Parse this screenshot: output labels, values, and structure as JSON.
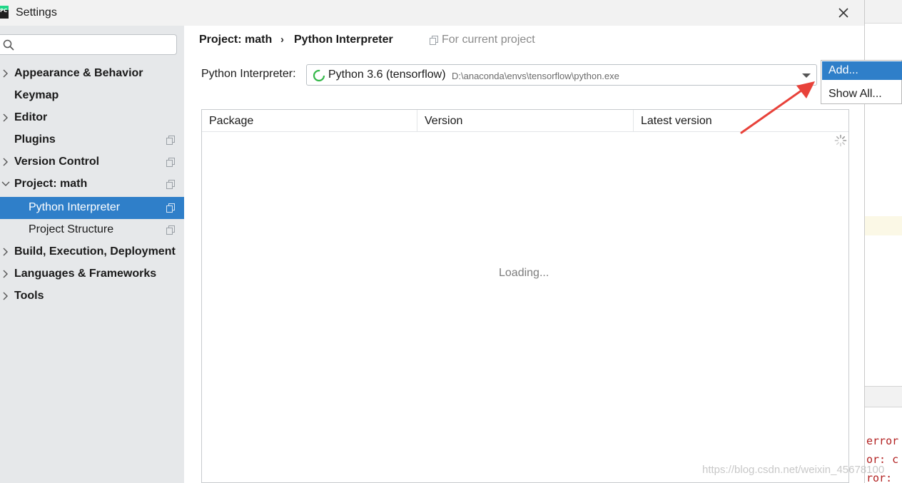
{
  "window": {
    "title": "Settings",
    "logo_text": "PC"
  },
  "sidebar": {
    "search": {
      "value": "",
      "placeholder": ""
    },
    "items": [
      {
        "label": "Appearance & Behavior",
        "expandable": true,
        "expanded": false,
        "level": 0,
        "has_copy_icon": false
      },
      {
        "label": "Keymap",
        "expandable": false,
        "level": 0,
        "has_copy_icon": false
      },
      {
        "label": "Editor",
        "expandable": true,
        "expanded": false,
        "level": 0,
        "has_copy_icon": false
      },
      {
        "label": "Plugins",
        "expandable": false,
        "level": 0,
        "has_copy_icon": true
      },
      {
        "label": "Version Control",
        "expandable": true,
        "expanded": false,
        "level": 0,
        "has_copy_icon": true
      },
      {
        "label": "Project: math",
        "expandable": true,
        "expanded": true,
        "level": 0,
        "has_copy_icon": true
      },
      {
        "label": "Python Interpreter",
        "expandable": false,
        "level": 1,
        "has_copy_icon": true,
        "selected": true
      },
      {
        "label": "Project Structure",
        "expandable": false,
        "level": 1,
        "has_copy_icon": true
      },
      {
        "label": "Build, Execution, Deployment",
        "expandable": true,
        "expanded": false,
        "level": 0,
        "has_copy_icon": false
      },
      {
        "label": "Languages & Frameworks",
        "expandable": true,
        "expanded": false,
        "level": 0,
        "has_copy_icon": false
      },
      {
        "label": "Tools",
        "expandable": true,
        "expanded": false,
        "level": 0,
        "has_copy_icon": false
      }
    ]
  },
  "breadcrumb": {
    "project": "Project: math",
    "separator": "›",
    "page": "Python Interpreter",
    "scope": "For current project"
  },
  "interpreter": {
    "label": "Python Interpreter:",
    "selected_name": "Python 3.6 (tensorflow)",
    "selected_path": "D:\\anaconda\\envs\\tensorflow\\python.exe"
  },
  "popup_menu": {
    "items": [
      "Add...",
      "Show All..."
    ],
    "highlighted": "Add..."
  },
  "packages_table": {
    "columns": [
      "Package",
      "Version",
      "Latest version"
    ],
    "rows": [],
    "loading_text": "Loading..."
  },
  "background_app": {
    "code_lines": [
      "error",
      "or: c",
      "ror:"
    ]
  },
  "watermark": "https://blog.csdn.net/weixin_45678100",
  "colors": {
    "selection": "#2f7fc9",
    "sidebar_bg": "#e6e8ea",
    "annotation_arrow": "#e8423a",
    "spinner": "#35b84a"
  },
  "icons": {
    "logo": "pycharm-logo",
    "search": "search-icon",
    "close": "close-icon",
    "expand": "chevron-right-icon",
    "collapse": "chevron-down-icon",
    "copy": "copy-icon",
    "loading": "spinner-icon",
    "dropdown": "dropdown-arrow-icon"
  }
}
